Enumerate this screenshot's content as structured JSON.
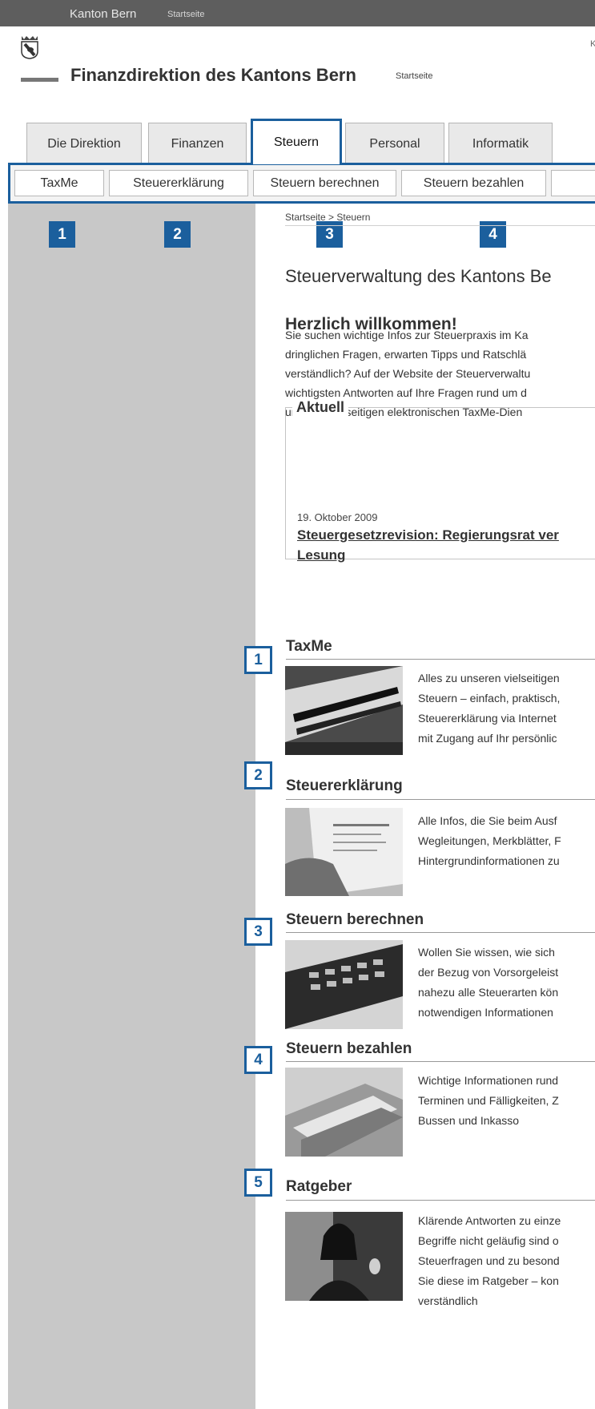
{
  "topbar": {
    "main": "Kanton Bern",
    "sub": "Startseite"
  },
  "corner_text": "K",
  "header": {
    "title": "Finanzdirektion des Kantons Bern",
    "home": "Startseite"
  },
  "tabs": [
    {
      "label": "Die Direktion"
    },
    {
      "label": "Finanzen"
    },
    {
      "label": "Steuern",
      "active": true
    },
    {
      "label": "Personal"
    },
    {
      "label": "Informatik"
    }
  ],
  "subnav": [
    {
      "label": "TaxMe"
    },
    {
      "label": "Steuererklärung"
    },
    {
      "label": "Steuern berechnen"
    },
    {
      "label": "Steuern bezahlen"
    },
    {
      "label": ""
    }
  ],
  "markers": [
    "1",
    "2",
    "3",
    "4"
  ],
  "breadcrumb": {
    "home": "Startseite",
    "sep": ">",
    "current": "Steuern"
  },
  "page_heading": "Steuerverwaltung des Kantons Be",
  "welcome": {
    "title": "Herzlich willkommen!",
    "lines": [
      "Sie suchen wichtige Infos zur Steuerpraxis im Ka",
      "dringlichen Fragen, erwarten Tipps und Ratschlä",
      "verständlich? Auf der Website der Steuerverwaltu",
      "wichtigsten Antworten auf Ihre Fragen rund um d",
      "unseren vielseitigen elektronischen TaxMe-Dien"
    ]
  },
  "news": {
    "legend": "Aktuell",
    "date": "19. Oktober 2009",
    "link_lines": [
      "Steuergesetzrevision: Regierungsrat ver",
      "Lesung"
    ]
  },
  "sections": [
    {
      "num": "1",
      "title": "TaxMe",
      "image": "taxme-keyboard-photo",
      "lines": [
        "Alles zu unseren vielseitigen",
        "Steuern – einfach, praktisch,",
        "Steuererklärung via Internet",
        "mit Zugang auf Ihr persönlic"
      ]
    },
    {
      "num": "2",
      "title": "Steuererklärung",
      "image": "tax-form-photo",
      "lines": [
        "Alle Infos, die Sie beim Ausf",
        "Wegleitungen, Merkblätter, F",
        "Hintergrundinformationen zu"
      ]
    },
    {
      "num": "3",
      "title": "Steuern berechnen",
      "image": "calculator-photo",
      "lines": [
        "Wollen Sie wissen, wie sich",
        "der Bezug von Vorsorgeleist",
        "nahezu alle Steuerarten kön",
        "notwendigen Informationen"
      ]
    },
    {
      "num": "4",
      "title": "Steuern bezahlen",
      "image": "banknotes-photo",
      "lines": [
        "Wichtige Informationen rund",
        "Terminen und Fälligkeiten, Z",
        "Bussen und Inkasso"
      ]
    },
    {
      "num": "5",
      "title": "Ratgeber",
      "image": "woman-portrait-photo",
      "lines": [
        "Klärende Antworten zu einze",
        "Begriffe nicht geläufig sind o",
        "Steuerfragen und zu besond",
        "Sie diese im Ratgeber – kon",
        "verständlich"
      ]
    }
  ]
}
